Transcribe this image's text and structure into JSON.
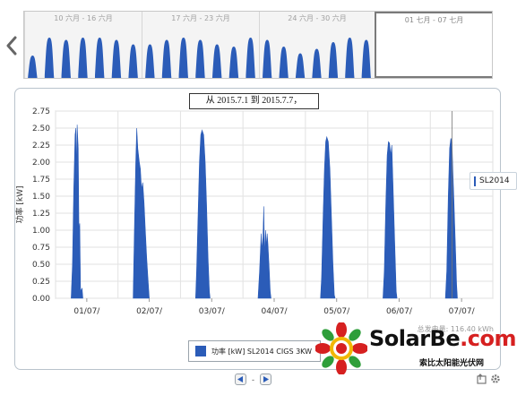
{
  "navigator": {
    "weeks": [
      {
        "label": "10 六月 - 16 六月",
        "selected": false
      },
      {
        "label": "17 六月 - 23 六月",
        "selected": false
      },
      {
        "label": "24 六月 - 30 六月",
        "selected": false
      },
      {
        "label": "01 七月 - 07 七月",
        "selected": true
      }
    ],
    "prev_icon": "chevron-left-icon"
  },
  "chart_title": "从 2015.7.1 到 2015.7.7，",
  "total_energy": "总发电量: 116.40 kWh",
  "legend_label": "功率 [kW] SL2014 CIGS 3KW",
  "series_tag": "SL2014",
  "logo": {
    "main": "SolarBe",
    "domain": ".com",
    "sub": "索比太阳能光伏网"
  },
  "colors": {
    "series": "#2b5cb8",
    "grid": "#e2e2e2",
    "nav_series": "#2b5cb8"
  },
  "chart_data": {
    "type": "area",
    "title": "从 2015.7.1 到 2015.7.7，",
    "xlabel": "",
    "ylabel": "功率 [kW]",
    "ylim": [
      0,
      2.75
    ],
    "yticks": [
      "0.00",
      "0.25",
      "0.50",
      "0.75",
      "1.00",
      "1.25",
      "1.50",
      "1.75",
      "2.00",
      "2.25",
      "2.50",
      "2.75"
    ],
    "categories": [
      "01/07/",
      "02/07/",
      "03/07/",
      "04/07/",
      "05/07/",
      "06/07/",
      "07/07/"
    ],
    "grid": true,
    "legend": "bottom",
    "series": [
      {
        "name": "功率 [kW] SL2014 CIGS 3KW",
        "days": [
          {
            "day": "01/07/",
            "points": [
              [
                6.0,
                0
              ],
              [
                6.5,
                0.5
              ],
              [
                7.0,
                1.6
              ],
              [
                7.5,
                2.4
              ],
              [
                7.8,
                2.5
              ],
              [
                8.1,
                1.8
              ],
              [
                8.3,
                2.55
              ],
              [
                8.7,
                2.2
              ],
              [
                9.0,
                1.0
              ],
              [
                9.3,
                1.1
              ],
              [
                9.6,
                0.1
              ],
              [
                10.2,
                0.15
              ],
              [
                10.5,
                0
              ]
            ]
          },
          {
            "day": "02/07/",
            "points": [
              [
                5.8,
                0
              ],
              [
                6.3,
                1.0
              ],
              [
                6.8,
                2.0
              ],
              [
                7.2,
                2.5
              ],
              [
                7.6,
                2.2
              ],
              [
                8.2,
                2.0
              ],
              [
                8.6,
                1.9
              ],
              [
                9.0,
                1.6
              ],
              [
                9.5,
                1.7
              ],
              [
                10.0,
                1.4
              ],
              [
                10.5,
                1.0
              ],
              [
                11.0,
                0.6
              ],
              [
                11.5,
                0.3
              ],
              [
                12.0,
                0
              ]
            ]
          },
          {
            "day": "03/07/",
            "points": [
              [
                5.8,
                0
              ],
              [
                6.2,
                0.4
              ],
              [
                6.8,
                1.3
              ],
              [
                7.3,
                2.0
              ],
              [
                7.8,
                2.4
              ],
              [
                8.3,
                2.47
              ],
              [
                8.9,
                2.4
              ],
              [
                9.5,
                2.0
              ],
              [
                10.0,
                1.4
              ],
              [
                10.6,
                0.6
              ],
              [
                11.1,
                0.1
              ],
              [
                11.4,
                0
              ]
            ]
          },
          {
            "day": "04/07/",
            "points": [
              [
                5.8,
                0
              ],
              [
                6.4,
                0.4
              ],
              [
                7.0,
                0.95
              ],
              [
                7.3,
                0.7
              ],
              [
                7.7,
                0.9
              ],
              [
                8.0,
                1.35
              ],
              [
                8.3,
                0.6
              ],
              [
                8.7,
                1.0
              ],
              [
                9.0,
                0.75
              ],
              [
                9.3,
                0.95
              ],
              [
                9.6,
                0.8
              ],
              [
                10.0,
                0.5
              ],
              [
                10.5,
                0.1
              ],
              [
                10.8,
                0
              ]
            ]
          },
          {
            "day": "05/07/",
            "points": [
              [
                5.8,
                0
              ],
              [
                6.2,
                0.3
              ],
              [
                6.8,
                1.2
              ],
              [
                7.3,
                1.9
              ],
              [
                7.8,
                2.3
              ],
              [
                8.2,
                2.37
              ],
              [
                8.8,
                2.3
              ],
              [
                9.4,
                1.9
              ],
              [
                10.0,
                1.2
              ],
              [
                10.6,
                0.5
              ],
              [
                11.1,
                0.05
              ],
              [
                11.4,
                0
              ]
            ]
          },
          {
            "day": "06/07/",
            "points": [
              [
                5.8,
                0
              ],
              [
                6.3,
                0.4
              ],
              [
                6.9,
                1.4
              ],
              [
                7.4,
                2.1
              ],
              [
                7.9,
                2.3
              ],
              [
                8.3,
                2.28
              ],
              [
                8.8,
                2.1
              ],
              [
                9.2,
                2.25
              ],
              [
                9.8,
                1.5
              ],
              [
                10.4,
                0.7
              ],
              [
                10.9,
                0.1
              ],
              [
                11.2,
                0
              ]
            ]
          },
          {
            "day": "07/07/",
            "points": [
              [
                5.8,
                0
              ],
              [
                6.3,
                0.4
              ],
              [
                6.9,
                1.5
              ],
              [
                7.4,
                2.2
              ],
              [
                7.9,
                2.35
              ],
              [
                8.3,
                2.3
              ],
              [
                8.7,
                1.8
              ],
              [
                9.1,
                1.4
              ],
              [
                9.6,
                0.8
              ],
              [
                10.1,
                0.2
              ],
              [
                10.4,
                0
              ]
            ]
          }
        ]
      }
    ]
  }
}
